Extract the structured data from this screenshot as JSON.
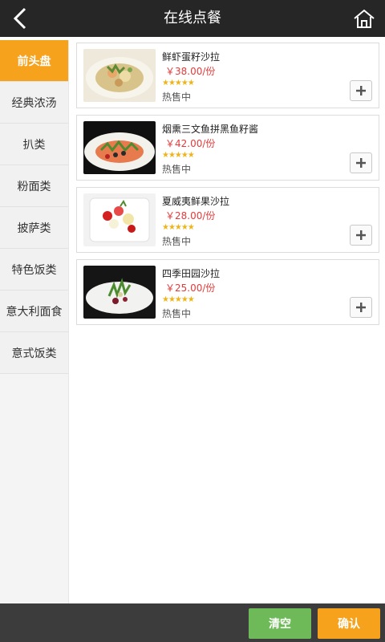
{
  "header": {
    "title": "在线点餐",
    "back_icon": "back-chevron-icon",
    "home_icon": "home-icon"
  },
  "sidebar": {
    "active_index": 0,
    "items": [
      {
        "label": "前头盘"
      },
      {
        "label": "经典浓汤"
      },
      {
        "label": "扒类"
      },
      {
        "label": "粉面类"
      },
      {
        "label": "披萨类"
      },
      {
        "label": "特色饭类"
      },
      {
        "label": "意大利面食"
      },
      {
        "label": "意式饭类"
      }
    ]
  },
  "dishes": [
    {
      "name": "鲜虾蛋籽沙拉",
      "price": "￥38.00/份",
      "stars": "★★★★★",
      "status": "热售中"
    },
    {
      "name": "烟熏三文鱼拼黑鱼籽酱",
      "price": "￥42.00/份",
      "stars": "★★★★★",
      "status": "热售中"
    },
    {
      "name": "夏威夷鲜果沙拉",
      "price": "￥28.00/份",
      "stars": "★★★★★",
      "status": "热售中"
    },
    {
      "name": "四季田园沙拉",
      "price": "￥25.00/份",
      "stars": "★★★★★",
      "status": "热售中"
    }
  ],
  "footer": {
    "clear_label": "清空",
    "confirm_label": "确认"
  },
  "colors": {
    "header_bg": "#262626",
    "accent_orange": "#f6a21d",
    "clear_green": "#6fba58",
    "price_red": "#e23b3b",
    "star_gold": "#f0b419",
    "footer_bg": "#3c3c3c"
  }
}
